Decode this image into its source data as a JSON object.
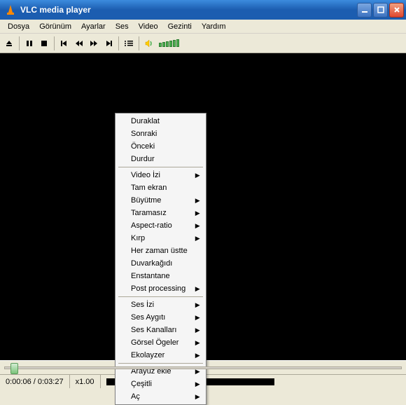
{
  "titlebar": {
    "title": "VLC media player"
  },
  "menubar": {
    "items": [
      "Dosya",
      "Görünüm",
      "Ayarlar",
      "Ses",
      "Video",
      "Gezinti",
      "Yardım"
    ]
  },
  "context_menu": {
    "group1": [
      {
        "label": "Duraklat",
        "submenu": false
      },
      {
        "label": "Sonraki",
        "submenu": false
      },
      {
        "label": "Önceki",
        "submenu": false
      },
      {
        "label": "Durdur",
        "submenu": false
      }
    ],
    "group2": [
      {
        "label": "Video İzi",
        "submenu": true
      },
      {
        "label": "Tam ekran",
        "submenu": false
      },
      {
        "label": "Büyütme",
        "submenu": true
      },
      {
        "label": "Taramasız",
        "submenu": true
      },
      {
        "label": "Aspect-ratio",
        "submenu": true
      },
      {
        "label": "Kırp",
        "submenu": true
      },
      {
        "label": "Her zaman üstte",
        "submenu": false
      },
      {
        "label": "Duvarkağıdı",
        "submenu": false
      },
      {
        "label": "Enstantane",
        "submenu": false
      },
      {
        "label": "Post processing",
        "submenu": true
      }
    ],
    "group3": [
      {
        "label": "Ses İzi",
        "submenu": true
      },
      {
        "label": "Ses Aygıtı",
        "submenu": true
      },
      {
        "label": "Ses Kanalları",
        "submenu": true
      },
      {
        "label": "Görsel Ögeler",
        "submenu": true
      },
      {
        "label": "Ekolayzer",
        "submenu": true
      }
    ],
    "group4": [
      {
        "label": "Arayüz ekle",
        "submenu": true
      },
      {
        "label": "Çeşitli",
        "submenu": true
      },
      {
        "label": "Aç",
        "submenu": true
      }
    ]
  },
  "status": {
    "time": "0:00:06 / 0:03:27",
    "speed": "x1.00"
  }
}
